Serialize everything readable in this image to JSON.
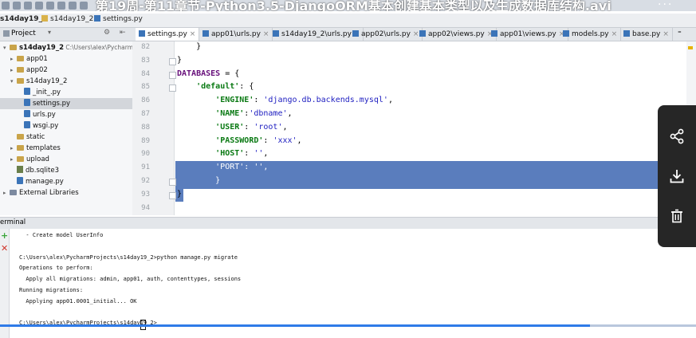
{
  "window": {
    "video_title": "第19周-第11章节-Python3.5-DjangoORM基本创建基本类型以及生成数据库结构.avi",
    "title_dots": "···"
  },
  "breadcrumbs": [
    "s14day19_2",
    "s14day19_2",
    "settings.py"
  ],
  "project": {
    "header": "Project",
    "tree": [
      {
        "label": "s14day19_2",
        "extra": "C:\\Users\\alex\\PycharmPro",
        "type": "folder",
        "indent": 0,
        "arrow": "▾"
      },
      {
        "label": "app01",
        "type": "folder",
        "indent": 1,
        "arrow": "▸"
      },
      {
        "label": "app02",
        "type": "folder",
        "indent": 1,
        "arrow": "▸"
      },
      {
        "label": "s14day19_2",
        "type": "folder",
        "indent": 1,
        "arrow": "▾"
      },
      {
        "label": "_init_.py",
        "type": "py",
        "indent": 2,
        "arrow": ""
      },
      {
        "label": "settings.py",
        "type": "py",
        "indent": 2,
        "arrow": "",
        "selected": true
      },
      {
        "label": "urls.py",
        "type": "py",
        "indent": 2,
        "arrow": ""
      },
      {
        "label": "wsgi.py",
        "type": "py",
        "indent": 2,
        "arrow": ""
      },
      {
        "label": "static",
        "type": "folder",
        "indent": 1,
        "arrow": ""
      },
      {
        "label": "templates",
        "type": "folder",
        "indent": 1,
        "arrow": "▸"
      },
      {
        "label": "upload",
        "type": "folder",
        "indent": 1,
        "arrow": "▸"
      },
      {
        "label": "db.sqlite3",
        "type": "db",
        "indent": 1,
        "arrow": ""
      },
      {
        "label": "manage.py",
        "type": "py",
        "indent": 1,
        "arrow": ""
      },
      {
        "label": "External Libraries",
        "type": "lib",
        "indent": 0,
        "arrow": "▸"
      }
    ]
  },
  "tabs": [
    {
      "label": "settings.py",
      "active": true
    },
    {
      "label": "app01\\urls.py"
    },
    {
      "label": "s14day19_2\\urls.py"
    },
    {
      "label": "app02\\urls.py"
    },
    {
      "label": "app02\\views.py"
    },
    {
      "label": "app01\\views.py"
    },
    {
      "label": "models.py"
    },
    {
      "label": "base.py"
    }
  ],
  "editor": {
    "lines": [
      {
        "n": "82",
        "code": "    }"
      },
      {
        "n": "83",
        "code": "}"
      },
      {
        "n": "84",
        "code": "DATABASES = {"
      },
      {
        "n": "85",
        "code": "    'default': {"
      },
      {
        "n": "86",
        "code": "        'ENGINE': 'django.db.backends.mysql',"
      },
      {
        "n": "87",
        "code": "        'NAME':'dbname',"
      },
      {
        "n": "88",
        "code": "        'USER': 'root',"
      },
      {
        "n": "89",
        "code": "        'PASSWORD': 'xxx',"
      },
      {
        "n": "90",
        "code": "        'HOST': '',"
      },
      {
        "n": "91",
        "code": "        'PORT': '',"
      },
      {
        "n": "92",
        "code": "        }"
      },
      {
        "n": "93",
        "code": "}"
      },
      {
        "n": "94",
        "code": ""
      }
    ]
  },
  "terminal": {
    "header": "erminal",
    "lines": [
      "  - Create model UserInfo",
      "",
      "C:\\Users\\alex\\PycharmProjects\\s14day19_2>python manage.py migrate",
      "Operations to perform:",
      "  Apply all migrations: admin, app01, auth, contenttypes, sessions",
      "Running migrations:",
      "  Applying app01.0001_initial... OK",
      "",
      "C:\\Users\\alex\\PycharmProjects\\s14day19_2>"
    ]
  },
  "side_panel": {
    "icons": [
      "share-icon",
      "download-icon",
      "trash-icon"
    ]
  }
}
